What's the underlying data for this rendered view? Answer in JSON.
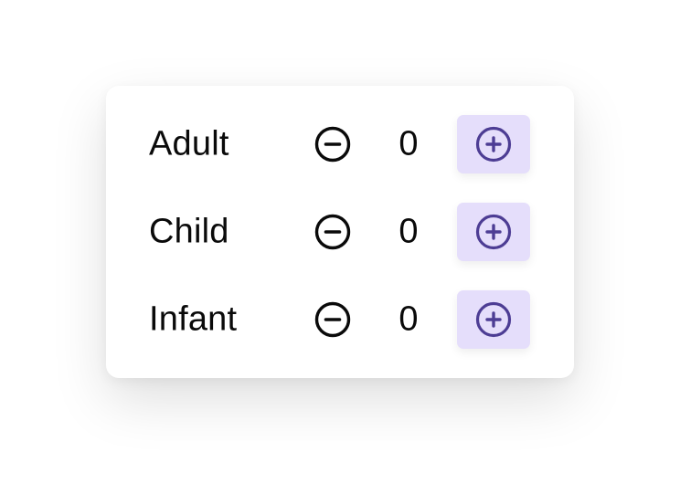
{
  "colors": {
    "accent": "#4d3d94",
    "accent_bg": "#e5defb",
    "text": "#0a0a0a"
  },
  "passenger_counter": {
    "rows": [
      {
        "label": "Adult",
        "value": "0",
        "decrement_icon": "minus-circle-icon",
        "increment_icon": "plus-circle-icon"
      },
      {
        "label": "Child",
        "value": "0",
        "decrement_icon": "minus-circle-icon",
        "increment_icon": "plus-circle-icon"
      },
      {
        "label": "Infant",
        "value": "0",
        "decrement_icon": "minus-circle-icon",
        "increment_icon": "plus-circle-icon"
      }
    ]
  }
}
